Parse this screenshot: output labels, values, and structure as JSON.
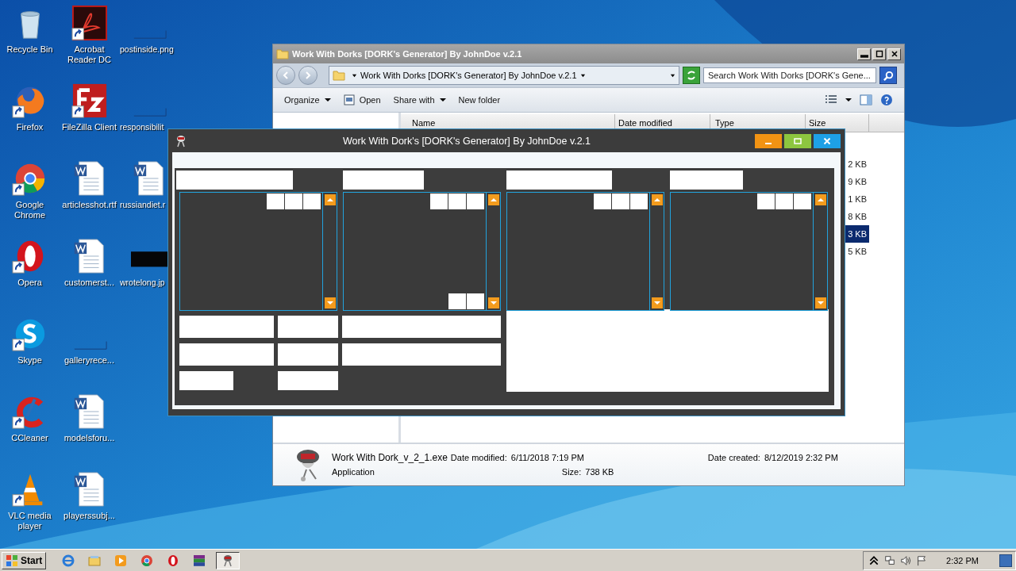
{
  "desktop_icons": [
    {
      "label": "Recycle Bin",
      "kind": "recycle",
      "shortcut": false
    },
    {
      "label": "Firefox",
      "kind": "firefox",
      "shortcut": true
    },
    {
      "label": "Google Chrome",
      "kind": "chrome",
      "shortcut": true
    },
    {
      "label": "Opera",
      "kind": "opera",
      "shortcut": true
    },
    {
      "label": "Skype",
      "kind": "skype",
      "shortcut": true
    },
    {
      "label": "CCleaner",
      "kind": "ccleaner",
      "shortcut": true
    },
    {
      "label": "VLC media player",
      "kind": "vlc",
      "shortcut": true
    },
    {
      "label": "Acrobat Reader DC",
      "kind": "pdf",
      "shortcut": true
    },
    {
      "label": "FileZilla Client",
      "kind": "filezilla",
      "shortcut": true
    },
    {
      "label": "articlesshot.rtf",
      "kind": "word",
      "shortcut": false
    },
    {
      "label": "customerst...",
      "kind": "word",
      "shortcut": false
    },
    {
      "label": "galleryrece...",
      "kind": "blank",
      "shortcut": false
    },
    {
      "label": "modelsforu...",
      "kind": "word",
      "shortcut": false
    },
    {
      "label": "playerssubj...",
      "kind": "word",
      "shortcut": false
    },
    {
      "label": "postinside.png",
      "kind": "blank",
      "shortcut": false
    },
    {
      "label": "responsibilit",
      "kind": "blank",
      "shortcut": false
    },
    {
      "label": "russiandiet.r",
      "kind": "word",
      "shortcut": false
    },
    {
      "label": "wrotelong.jp",
      "kind": "black",
      "shortcut": false
    }
  ],
  "explorer": {
    "title": "Work With Dorks [DORK's Generator] By JohnDoe v.2.1",
    "address": "Work With Dorks [DORK's Generator] By JohnDoe v.2.1",
    "search": {
      "placeholder": "Search Work With Dorks [DORK's Gene..."
    },
    "toolbar": [
      {
        "label": "Organize",
        "kind": "dropdown"
      },
      {
        "label": "Open",
        "kind": "icon"
      },
      {
        "label": "Share with",
        "kind": "dropdown"
      },
      {
        "label": "New folder",
        "kind": "plain"
      }
    ],
    "columns": [
      "Name",
      "Date modified",
      "Type",
      "Size"
    ],
    "rows": [
      {
        "size": "2 KB",
        "selected": false
      },
      {
        "size": "9 KB",
        "selected": false
      },
      {
        "size": "1 KB",
        "selected": false
      },
      {
        "size": "8 KB",
        "selected": false
      },
      {
        "size": "3 KB",
        "selected": true
      },
      {
        "size": "5 KB",
        "selected": false
      }
    ],
    "details": {
      "name": "Work With Dork_v_2_1.exe",
      "type": "Application",
      "fields": [
        {
          "label": "Date modified:",
          "value": "6/11/2018 7:19 PM"
        },
        {
          "label": "Date created:",
          "value": "8/12/2019 2:32 PM"
        },
        {
          "label": "Size:",
          "value": "738 KB"
        }
      ]
    }
  },
  "app_window": {
    "title": "Work With Dork's [DORK's Generator] By JohnDoe v.2.1"
  },
  "taskbar": {
    "start": "Start",
    "apps": [
      {
        "kind": "ie",
        "selected": false
      },
      {
        "kind": "explorer",
        "selected": false
      },
      {
        "kind": "media",
        "selected": false
      },
      {
        "kind": "chrome",
        "selected": false
      },
      {
        "kind": "opera",
        "selected": false
      },
      {
        "kind": "winrar",
        "selected": false
      },
      {
        "kind": "app",
        "selected": true
      }
    ],
    "clock": "2:32 PM"
  }
}
